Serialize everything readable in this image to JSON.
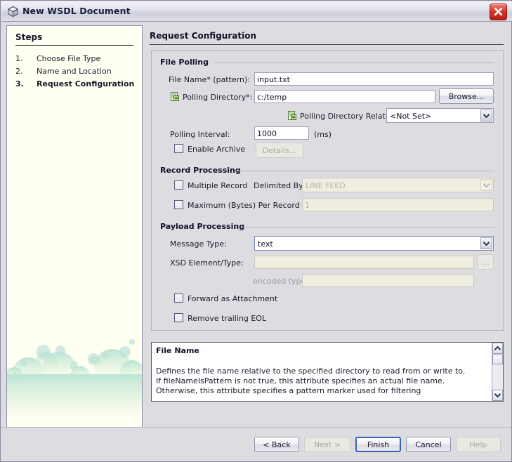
{
  "window": {
    "title": "New WSDL Document",
    "title_icon": "cube-icon",
    "close_icon": "close-icon"
  },
  "sidebar": {
    "heading": "Steps",
    "items": [
      {
        "num": "1.",
        "label": "Choose File Type",
        "active": false
      },
      {
        "num": "2.",
        "label": "Name and Location",
        "active": false
      },
      {
        "num": "3.",
        "label": "Request Configuration",
        "active": true
      }
    ]
  },
  "main": {
    "page_title": "Request Configuration",
    "groups": {
      "file_polling": {
        "title": "File Polling",
        "file_name_label": "File Name* (pattern):",
        "file_name_value": "input.txt",
        "polling_directory_label": "Polling Directory*:",
        "polling_directory_value": "c:/temp",
        "polling_directory_icon": "directory-file-icon",
        "browse_label": "Browse...",
        "relative_to_label": "Polling Directory Relative To:",
        "relative_to_icon": "directory-file-icon",
        "relative_to_value": "<Not Set>",
        "polling_interval_label": "Polling Interval:",
        "polling_interval_value": "1000",
        "polling_interval_units": "(ms)",
        "enable_archive_label": "Enable Archive",
        "enable_archive_checked": false,
        "details_label": "Details..."
      },
      "record_processing": {
        "title": "Record Processing",
        "multiple_record_label": "Multiple Record",
        "multiple_record_checked": false,
        "delimited_by_label": "Delimited By:",
        "delimited_by_value": "LINE FEED",
        "maximum_bytes_label": "Maximum (Bytes) Per Record",
        "maximum_bytes_checked": false,
        "maximum_bytes_value": "1"
      },
      "payload_processing": {
        "title": "Payload Processing",
        "message_type_label": "Message Type:",
        "message_type_value": "text",
        "xsd_element_label": "XSD Element/Type:",
        "xsd_element_value": "",
        "xsd_browse_label": "...",
        "encoded_type_label": "encoded type:",
        "encoded_type_value": "",
        "forward_as_attachment_label": "Forward as Attachment",
        "forward_as_attachment_checked": false,
        "remove_trailing_eol_label": "Remove trailing EOL",
        "remove_trailing_eol_checked": false
      }
    }
  },
  "description": {
    "title": "File Name",
    "lines": [
      "Defines the file name relative to the specified directory to read from or write to.",
      "If fileNameIsPattern is not true, this attribute specifies an actual file name.",
      "Otherwise, this attribute specifies a pattern marker used for filtering"
    ],
    "scroll_up_icon": "chevron-up-icon",
    "scroll_down_icon": "chevron-down-icon"
  },
  "footer": {
    "back_label": "< Back",
    "next_label": "Next >",
    "finish_label": "Finish",
    "cancel_label": "Cancel",
    "help_label": "Help"
  },
  "colors": {
    "dialog_bg": "#dcdce1",
    "steps_bg": "#fffff2",
    "focus_border": "#3a62b4",
    "disabled_field_bg": "#f0eee1",
    "close_red": "#d8362c"
  }
}
